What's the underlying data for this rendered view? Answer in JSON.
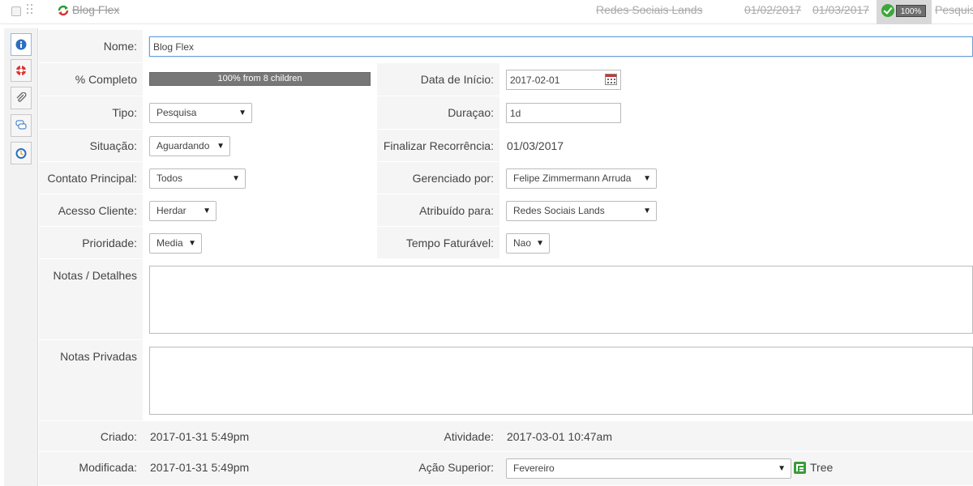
{
  "task_row": {
    "title": "Blog Flex",
    "assignee": "Redes Sociais Lands",
    "start_date": "01/02/2017",
    "end_date": "01/03/2017",
    "percent": "100%",
    "type": "Pesquisa"
  },
  "sidebar": {
    "items": [
      "info-icon",
      "lifebuoy-icon",
      "paperclip-icon",
      "comments-icon",
      "clock-icon"
    ]
  },
  "form": {
    "name": {
      "label": "Nome:",
      "value": "Blog Flex"
    },
    "percent_complete": {
      "label": "% Completo",
      "text": "100% from 8 children",
      "value": 1.0
    },
    "start_date": {
      "label": "Data de Início:",
      "value": "2017-02-01"
    },
    "type": {
      "label": "Tipo:",
      "value": "Pesquisa"
    },
    "duration": {
      "label": "Duraçao:",
      "value": "1d"
    },
    "status": {
      "label": "Situação:",
      "value": "Aguardando"
    },
    "end_recurrence": {
      "label": "Finalizar Recorrência:",
      "value": "01/03/2017"
    },
    "main_contact": {
      "label": "Contato Principal:",
      "value": "Todos"
    },
    "managed_by": {
      "label": "Gerenciado por:",
      "value": "Felipe Zimmermann Arruda"
    },
    "client_access": {
      "label": "Acesso Cliente:",
      "value": "Herdar"
    },
    "assigned_to": {
      "label": "Atribuído para:",
      "value": "Redes Sociais Lands"
    },
    "priority": {
      "label": "Prioridade:",
      "value": "Media"
    },
    "billable_time": {
      "label": "Tempo Faturável:",
      "value": "Nao"
    },
    "notes": {
      "label": "Notas / Detalhes",
      "value": ""
    },
    "private_notes": {
      "label": "Notas Privadas",
      "value": ""
    },
    "created": {
      "label": "Criado:",
      "value": "2017-01-31 5:49pm"
    },
    "activity": {
      "label": "Atividade:",
      "value": "2017-03-01 10:47am"
    },
    "modified": {
      "label": "Modificada:",
      "value": "2017-01-31 5:49pm"
    },
    "parent_action": {
      "label": "Ação Superior:",
      "value": "Fevereiro"
    },
    "tree_label": "Tree"
  },
  "colors": {
    "check_green": "#3aa83a",
    "progress_fill": "#777777",
    "focus_border": "#6aa0d8"
  }
}
